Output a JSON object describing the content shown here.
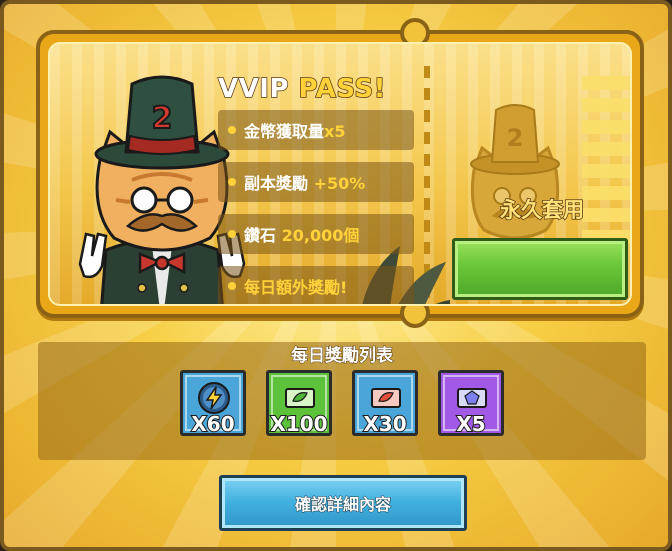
{
  "pass": {
    "title_white": "VVIP",
    "title_gold": "PASS!",
    "features": [
      {
        "text": "金幣獲取量",
        "highlight": "x5"
      },
      {
        "text": "副本獎勵",
        "highlight": "+50%"
      },
      {
        "text": "鑽石",
        "highlight": "20,000個"
      },
      {
        "text": "每日額外獎勵!",
        "highlight": ""
      }
    ],
    "hat_number": "2",
    "stub_label": "永久套用"
  },
  "daily": {
    "title": "每日獎勵列表",
    "items": [
      {
        "icon": "lightning-icon",
        "quantity": "X60",
        "color": "#4aa6d8"
      },
      {
        "icon": "green-ticket-icon",
        "quantity": "X100",
        "color": "#5cc23a"
      },
      {
        "icon": "red-ticket-icon",
        "quantity": "X30",
        "color": "#4aa6d8"
      },
      {
        "icon": "purple-gem-icon",
        "quantity": "X5",
        "color": "#a25ae6"
      }
    ]
  },
  "confirm_label": "確認詳細內容"
}
